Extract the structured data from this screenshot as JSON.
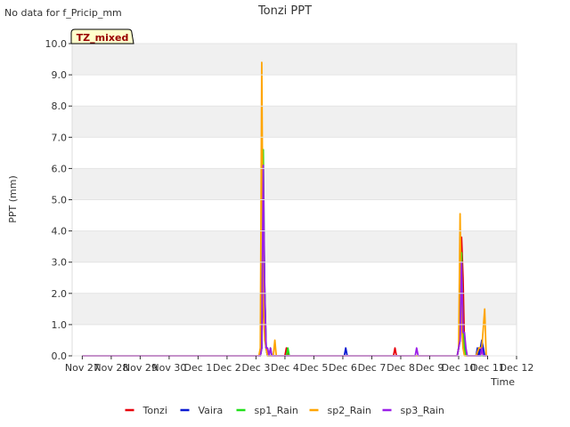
{
  "header": {
    "title": "Tonzi PPT",
    "nodata": "No data for f_Pricip_mm",
    "badge": "TZ_mixed"
  },
  "colors": {
    "Tonzi": "#e8000b",
    "Vaira": "#0a1ad2",
    "sp1_Rain": "#22e01b",
    "sp2_Rain": "#ffa500",
    "sp3_Rain": "#9b1fe8",
    "band": "#f0f0f0",
    "badge_bg": "#ffffcc",
    "badge_text": "#990000"
  },
  "chart_data": {
    "type": "line",
    "title": "Tonzi PPT",
    "xlabel": "Time",
    "ylabel": "PPT (mm)",
    "xlim": [
      -0.35,
      15.0
    ],
    "ylim": [
      0,
      10
    ],
    "yticks": [
      0,
      1,
      2,
      3,
      4,
      5,
      6,
      7,
      8,
      9,
      10
    ],
    "ytick_labels": [
      "0.0",
      "1.0",
      "2.0",
      "3.0",
      "4.0",
      "5.0",
      "6.0",
      "7.0",
      "8.0",
      "9.0",
      "10.0"
    ],
    "xticks": [
      0,
      1,
      2,
      3,
      4,
      5,
      6,
      7,
      8,
      9,
      10,
      11,
      12,
      13,
      14,
      15
    ],
    "xtick_labels": [
      "Nov 27",
      "Nov 28",
      "Nov 29",
      "Nov 30",
      "Dec 1",
      "Dec 2",
      "Dec 3",
      "Dec 4",
      "Dec 5",
      "Dec 6",
      "Dec 7",
      "Dec 8",
      "Dec 9",
      "Dec 10",
      "Dec 11",
      "Dec 12"
    ],
    "legend_position": "bottom",
    "grid": "alternating horizontal bands",
    "series": [
      {
        "name": "Tonzi",
        "x": [
          0.0,
          6.15,
          6.2,
          6.25,
          6.3,
          6.35,
          6.4,
          6.45,
          6.5,
          7.0,
          7.05,
          7.1,
          10.75,
          10.8,
          10.85,
          12.95,
          13.0,
          13.05,
          13.1,
          13.15,
          13.2,
          13.25,
          13.3,
          13.4,
          13.65,
          13.7,
          13.75,
          13.8,
          13.85,
          14.0
        ],
        "y": [
          0,
          0,
          0.25,
          3.2,
          1.0,
          0.25,
          0,
          0,
          0,
          0,
          0.25,
          0,
          0,
          0.25,
          0,
          0,
          0.25,
          1.0,
          3.8,
          2.5,
          0.25,
          0,
          0,
          0,
          0,
          0.25,
          0,
          0.25,
          0,
          0
        ]
      },
      {
        "name": "Vaira",
        "x": [
          0.0,
          6.15,
          6.2,
          6.25,
          6.3,
          6.35,
          6.4,
          6.45,
          6.5,
          9.05,
          9.1,
          9.15,
          12.95,
          13.0,
          13.05,
          13.1,
          13.15,
          13.2,
          13.25,
          13.3,
          13.6,
          13.65,
          13.7,
          13.75,
          13.8,
          13.85,
          13.9,
          14.0
        ],
        "y": [
          0,
          0,
          0.25,
          5.0,
          2.2,
          0.25,
          0,
          0,
          0,
          0,
          0.25,
          0,
          0,
          0.25,
          0.5,
          3.0,
          0.5,
          0.25,
          0,
          0,
          0,
          0.25,
          0,
          0.25,
          0.5,
          0.25,
          0,
          0
        ]
      },
      {
        "name": "sp1_Rain",
        "x": [
          0.0,
          6.15,
          6.2,
          6.25,
          6.3,
          6.35,
          6.4,
          6.45,
          6.5,
          6.55,
          7.05,
          7.1,
          7.15,
          7.2,
          12.95,
          13.0,
          13.05,
          13.1,
          13.15,
          13.2,
          13.25,
          13.3,
          14.0
        ],
        "y": [
          0,
          0,
          0.25,
          6.6,
          2.0,
          0.25,
          0,
          0,
          0.25,
          0,
          0,
          0.25,
          0,
          0,
          0,
          0.25,
          0.8,
          3.3,
          0.8,
          0.25,
          0,
          0,
          0
        ]
      },
      {
        "name": "sp2_Rain",
        "x": [
          0.0,
          6.1,
          6.15,
          6.2,
          6.25,
          6.3,
          6.35,
          6.4,
          6.45,
          6.6,
          6.65,
          6.7,
          6.75,
          12.95,
          13.0,
          13.05,
          13.1,
          13.15,
          13.2,
          13.25,
          13.6,
          13.7,
          13.8,
          13.9,
          13.95,
          14.0
        ],
        "y": [
          0,
          0,
          0.25,
          9.4,
          2.0,
          0.5,
          0.25,
          0,
          0,
          0,
          0.5,
          0,
          0,
          0,
          0.25,
          4.55,
          1.0,
          0.25,
          0,
          0,
          0,
          0.25,
          0.25,
          1.5,
          0,
          0
        ]
      },
      {
        "name": "sp3_Rain",
        "x": [
          0.0,
          6.15,
          6.2,
          6.25,
          6.3,
          6.35,
          6.4,
          6.45,
          6.5,
          6.55,
          6.6,
          11.5,
          11.55,
          11.6,
          12.95,
          13.0,
          13.05,
          13.1,
          13.15,
          13.2,
          13.25,
          13.3,
          13.35,
          13.75,
          13.8,
          13.85,
          14.0
        ],
        "y": [
          0,
          0,
          0.25,
          6.1,
          2.0,
          0.25,
          0.25,
          0,
          0.25,
          0,
          0,
          0,
          0.25,
          0,
          0,
          0.25,
          0.5,
          3.0,
          0.75,
          0.75,
          0.25,
          0,
          0,
          0,
          0.25,
          0,
          0
        ]
      }
    ]
  }
}
